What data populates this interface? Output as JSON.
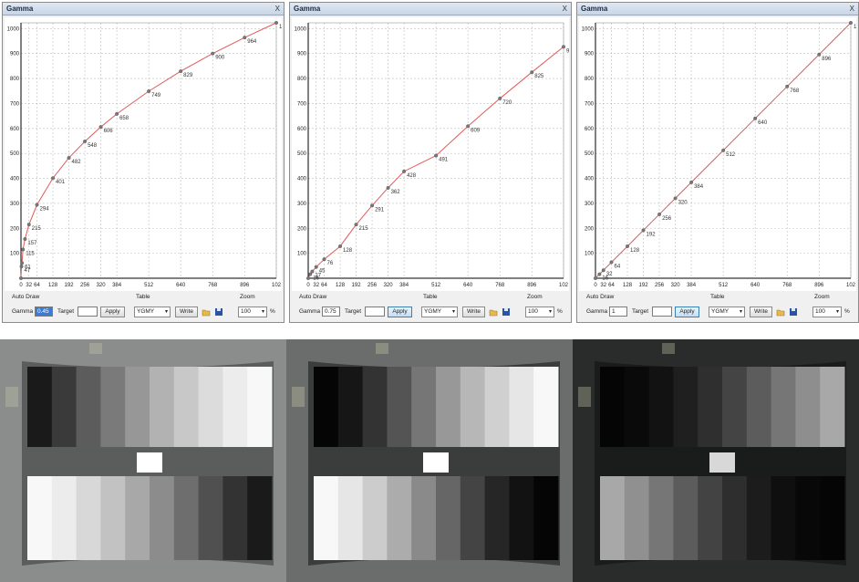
{
  "windows": [
    {
      "title": "Gamma",
      "close_label": "X",
      "auto_draw_label": "Auto Draw",
      "gamma_label": "Gamma",
      "gamma_value": "0.45",
      "gamma_selected": true,
      "target_label": "Target",
      "target_value": "",
      "apply_label": "Apply",
      "table_label": "Table",
      "table_value": "YGMY",
      "write_label": "Write",
      "zoom_label": "Zoom",
      "zoom_value": "100",
      "zoom_unit": "%",
      "chart_data": {
        "type": "line",
        "xlim": [
          0,
          1023
        ],
        "ylim": [
          0,
          1023
        ],
        "x_ticks": [
          "0",
          "32",
          "64",
          "128",
          "192",
          "256",
          "320",
          "384",
          "512",
          "640",
          "768",
          "896",
          "102"
        ],
        "y_ticks": [
          "100",
          "200",
          "300",
          "400",
          "500",
          "600",
          "700",
          "800",
          "900",
          "1000"
        ],
        "x": [
          0,
          2,
          4,
          8,
          16,
          32,
          64,
          128,
          192,
          256,
          320,
          384,
          512,
          640,
          768,
          896,
          1023
        ],
        "y": [
          0,
          47,
          61,
          115,
          157,
          215,
          294,
          401,
          482,
          548,
          606,
          658,
          749,
          829,
          900,
          964,
          1023
        ],
        "point_labels": [
          "",
          "47",
          "61",
          "115",
          "157",
          "215",
          "294",
          "401",
          "482",
          "548",
          "606",
          "658",
          "749",
          "829",
          "900",
          "964",
          "102"
        ],
        "line_color": "#e05a5a",
        "grid": true
      }
    },
    {
      "title": "Gamma",
      "close_label": "X",
      "auto_draw_label": "Auto Draw",
      "gamma_label": "Gamma",
      "gamma_value": "0.75",
      "gamma_selected": false,
      "target_label": "Target",
      "target_value": "",
      "apply_label": "Apply",
      "table_label": "Table",
      "table_value": "YGMY",
      "write_label": "Write",
      "zoom_label": "Zoom",
      "zoom_value": "100",
      "zoom_unit": "%",
      "chart_data": {
        "type": "line",
        "xlim": [
          0,
          1023
        ],
        "ylim": [
          0,
          1023
        ],
        "x_ticks": [
          "0",
          "32",
          "64",
          "128",
          "192",
          "256",
          "320",
          "384",
          "512",
          "640",
          "768",
          "896",
          "102"
        ],
        "y_ticks": [
          "100",
          "200",
          "300",
          "400",
          "500",
          "600",
          "700",
          "800",
          "900",
          "1000"
        ],
        "x": [
          0,
          8,
          16,
          32,
          64,
          128,
          192,
          256,
          320,
          384,
          512,
          640,
          768,
          896,
          1023
        ],
        "y": [
          0,
          16,
          27,
          45,
          76,
          128,
          215,
          291,
          362,
          428,
          491,
          609,
          720,
          825,
          927,
          1023
        ],
        "point_labels": [
          "",
          "16",
          "27",
          "45",
          "76",
          "128",
          "215",
          "291",
          "362",
          "428",
          "491",
          "609",
          "720",
          "825",
          "927",
          "102"
        ],
        "line_color": "#e05a5a",
        "grid": true
      }
    },
    {
      "title": "Gamma",
      "close_label": "X",
      "auto_draw_label": "Auto Draw",
      "gamma_label": "Gamma",
      "gamma_value": "1",
      "gamma_selected": false,
      "target_label": "Target",
      "target_value": "",
      "apply_label": "Apply",
      "table_label": "Table",
      "table_value": "YGMY",
      "write_label": "Write",
      "zoom_label": "Zoom",
      "zoom_value": "100",
      "zoom_unit": "%",
      "chart_data": {
        "type": "line",
        "xlim": [
          0,
          1023
        ],
        "ylim": [
          0,
          1023
        ],
        "x_ticks": [
          "0",
          "32",
          "64",
          "128",
          "192",
          "256",
          "320",
          "384",
          "512",
          "640",
          "768",
          "896",
          "102"
        ],
        "y_ticks": [
          "100",
          "200",
          "300",
          "400",
          "500",
          "600",
          "700",
          "800",
          "900",
          "1000"
        ],
        "x": [
          0,
          16,
          32,
          64,
          128,
          192,
          256,
          320,
          384,
          512,
          640,
          768,
          896,
          1023
        ],
        "y": [
          0,
          16,
          32,
          64,
          128,
          192,
          256,
          320,
          384,
          512,
          640,
          768,
          896,
          1023
        ],
        "point_labels": [
          "",
          "16",
          "32",
          "64",
          "128",
          "192",
          "256",
          "320",
          "384",
          "512",
          "640",
          "768",
          "896",
          "102"
        ],
        "line_color": "#e05a5a",
        "grid": true
      }
    }
  ],
  "photos": [
    {
      "background": "#8a8d8c",
      "card_color": "#5a5d5c",
      "center_patch": "#ffffff",
      "top_row": [
        "#1a1a1a",
        "#3a3a3a",
        "#5c5c5c",
        "#7a7a7a",
        "#979797",
        "#b2b2b2",
        "#c8c8c8",
        "#dcdcdc",
        "#ececec",
        "#f8f8f8"
      ],
      "bottom_row": [
        "#f8f8f8",
        "#ececec",
        "#d8d8d8",
        "#c2c2c2",
        "#a8a8a8",
        "#8c8c8c",
        "#6e6e6e",
        "#505050",
        "#333333",
        "#1a1a1a"
      ]
    },
    {
      "background": "#6a6d6c",
      "card_color": "#3a3d3c",
      "center_patch": "#ffffff",
      "top_row": [
        "#050505",
        "#161616",
        "#333333",
        "#545454",
        "#767676",
        "#989898",
        "#b7b7b7",
        "#d0d0d0",
        "#e6e6e6",
        "#f8f8f8"
      ],
      "bottom_row": [
        "#f8f8f8",
        "#e6e6e6",
        "#cccccc",
        "#acacac",
        "#8a8a8a",
        "#666666",
        "#444444",
        "#262626",
        "#121212",
        "#050505"
      ]
    },
    {
      "background": "#2a2c2b",
      "card_color": "#1a1b1b",
      "center_patch": "#d8d8d8",
      "top_row": [
        "#050505",
        "#0a0a0a",
        "#121212",
        "#1f1f1f",
        "#2f2f2f",
        "#444444",
        "#5c5c5c",
        "#767676",
        "#8e8e8e",
        "#a8a8a8"
      ],
      "bottom_row": [
        "#a8a8a8",
        "#909090",
        "#767676",
        "#5c5c5c",
        "#434343",
        "#2e2e2e",
        "#1c1c1c",
        "#0f0f0f",
        "#080808",
        "#050505"
      ]
    }
  ]
}
